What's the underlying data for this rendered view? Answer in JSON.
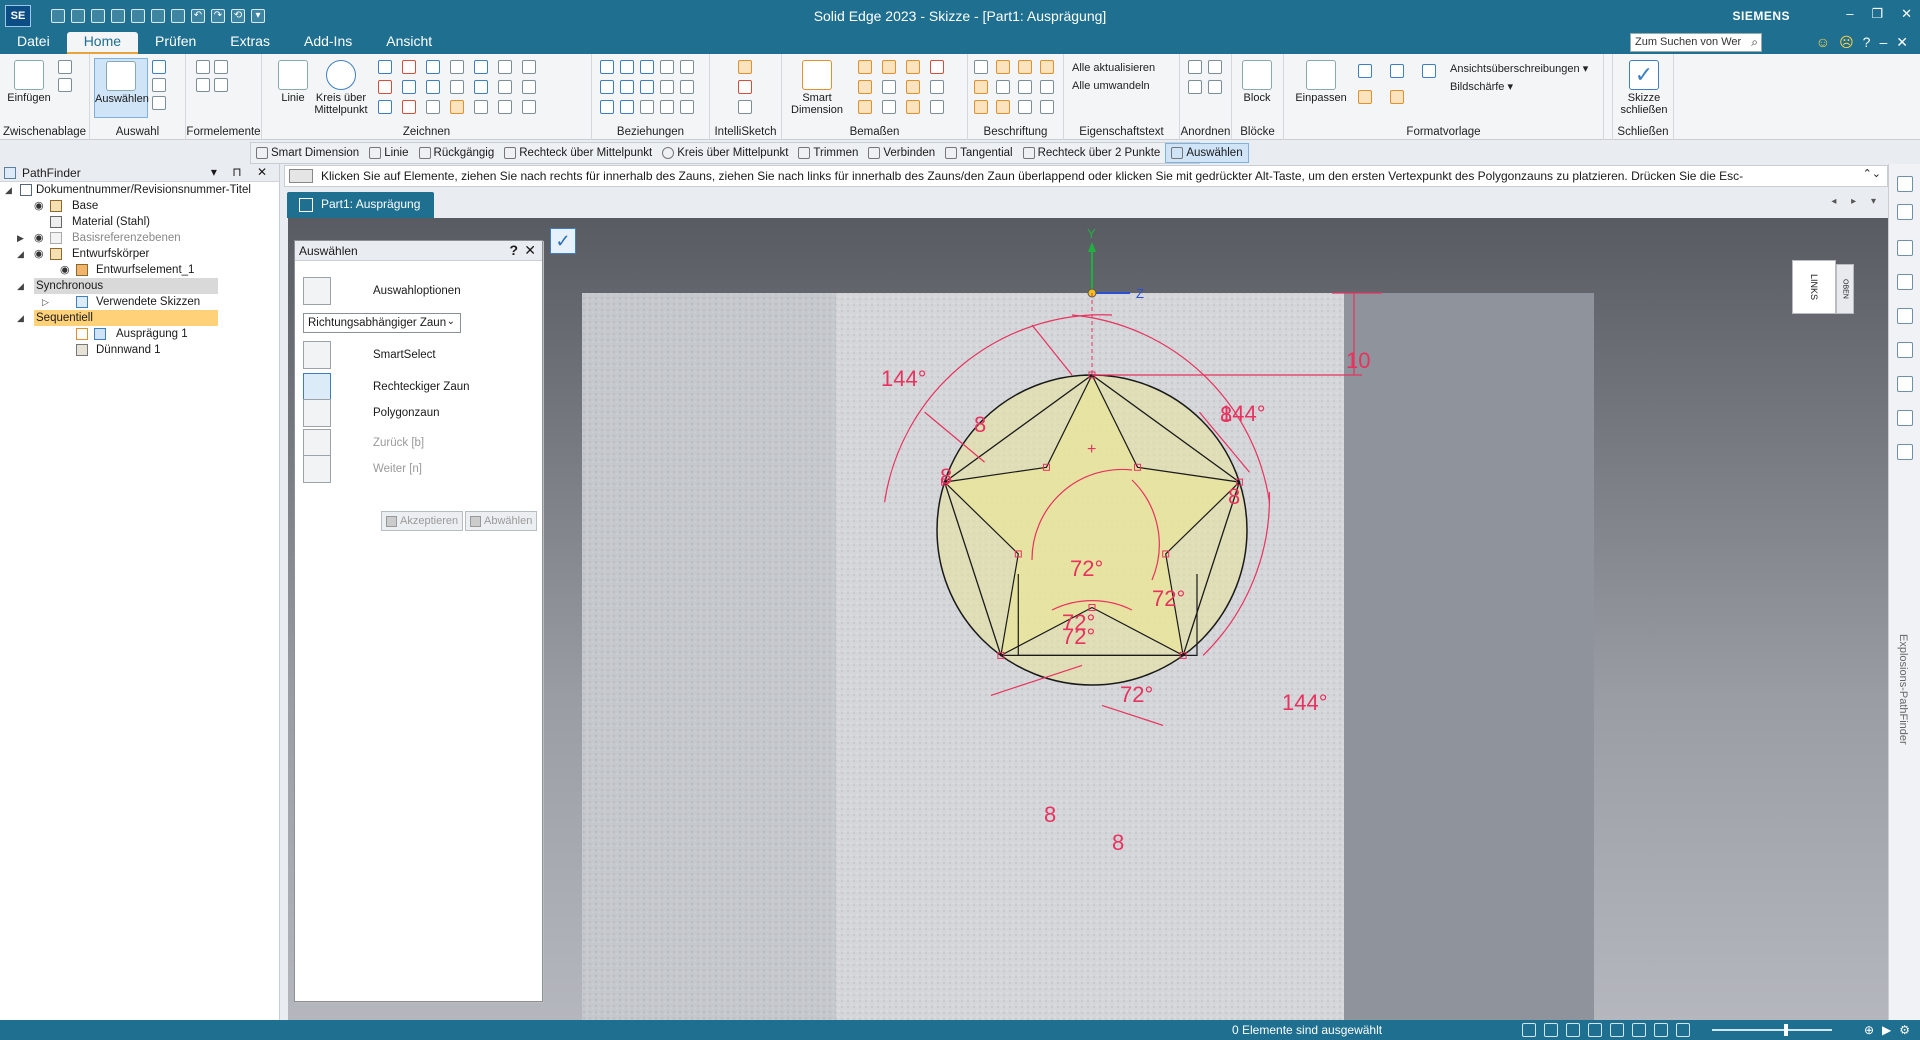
{
  "app": {
    "logo": "SE",
    "title": "Solid Edge 2023 - Skizze - [Part1: Ausprägung]",
    "brand": "SIEMENS",
    "window_controls": [
      "–",
      "❐",
      "✕"
    ]
  },
  "menu": {
    "items": [
      "Datei",
      "Home",
      "Prüfen",
      "Extras",
      "Add-Ins",
      "Ansicht"
    ],
    "search_placeholder": "Zum Suchen von Wer",
    "feedback_icons": [
      "☺",
      "☹",
      "?",
      "–",
      "✕"
    ]
  },
  "ribbon": {
    "groups": {
      "zwischenablage": "Zwischenablage",
      "auswahl": "Auswahl",
      "formelemente": "Formelemente",
      "zeichnen": "Zeichnen",
      "beziehungen": "Beziehungen",
      "intellisketch": "IntelliSketch",
      "bemassen": "Bemaßen",
      "beschriftung": "Beschriftung",
      "eigenschaftstext": "Eigenschaftstext",
      "anordnen": "Anordnen",
      "bloecke": "Blöcke",
      "formatvorlage": "Formatvorlage",
      "schliessen": "Schließen"
    },
    "buttons": {
      "einfuegen": "Einfügen",
      "auswaehlen": "Auswählen",
      "linie": "Linie",
      "kreis": "Kreis über Mittelpunkt",
      "smart_dimension": "Smart Dimension",
      "block": "Block",
      "einpassen": "Einpassen",
      "skizze_schliessen": "Skizze schließen",
      "alle_aktualisieren": "Alle aktualisieren",
      "alle_umwandeln": "Alle umwandeln",
      "ansichtsueberschreibungen": "Ansichtsüberschreibungen",
      "bildschaerfe": "Bildschärfe"
    }
  },
  "command_bar": {
    "items": [
      "Smart Dimension",
      "Linie",
      "Rückgängig",
      "Rechteck über Mittelpunkt",
      "Kreis über Mittelpunkt",
      "Trimmen",
      "Verbinden",
      "Tangential",
      "Rechteck über 2 Punkte",
      "Auswählen"
    ]
  },
  "prompt": "Klicken Sie auf Elemente, ziehen Sie nach rechts für innerhalb des Zauns, ziehen Sie nach links für innerhalb des Zauns/den Zaun überlappend oder klicken Sie mit gedrückter Alt-Taste, um den ersten Vertexpunkt des Polygonzauns zu platzieren. Drücken Sie die Esc-",
  "pathfinder": {
    "title": "PathFinder",
    "controls": "▾ ⊓ ✕",
    "tree": {
      "root": "Dokumentnummer/Revisionsnummer-Titel",
      "base": "Base",
      "material": "Material (Stahl)",
      "basisreferenzebenen": "Basisreferenzebenen",
      "entwurfskoerper": "Entwurfskörper",
      "entwurfselement": "Entwurfselement_1",
      "synchronous": "Synchronous",
      "verwendete_skizzen": "Verwendete Skizzen",
      "sequentiell": "Sequentiell",
      "auspraegung": "Ausprägung 1",
      "duennwand": "Dünnwand 1"
    }
  },
  "document": {
    "tab": "Part1: Ausprägung",
    "tab_nav": "◂ ▸ ▾"
  },
  "select_panel": {
    "title": "Auswählen",
    "help": "?",
    "close": "✕",
    "options_label": "Auswahloptionen",
    "fence_mode": "Richtungsabhängiger Zaun",
    "smartselect": "SmartSelect",
    "rect_fence": "Rechteckiger Zaun",
    "poly_fence": "Polygonzaun",
    "back": "Zurück [b]",
    "forward": "Weiter [n]",
    "accept": "Akzeptieren",
    "deselect": "Abwählen"
  },
  "viewcube": {
    "face": "LINKS",
    "side": "OBEN"
  },
  "axes": {
    "y": "Y",
    "z": "Z"
  },
  "right_dock": {
    "label": "Explosions-PathFinder"
  },
  "status": {
    "text": "0 Elemente sind ausgewählt"
  },
  "sketch": {
    "dimensions": {
      "angle_top_left": "144°",
      "angle_top_right": "144°",
      "angle_right": "144°",
      "length_top_left": "8",
      "length_left": "8",
      "length_right": "8",
      "length_top_right_overlap": "8",
      "length_bottom_left": "8",
      "length_bottom_right": "8",
      "height": "10",
      "angle_center_1": "72°",
      "angle_center_2": "72°",
      "angle_center_3": "72°",
      "angle_center_4": "72°",
      "angle_center_5": "72°"
    },
    "colors": {
      "dimension": "#e8325f",
      "fill": "#e9e59a",
      "geometry": "#1a1a1a",
      "accent": "#1e6f90"
    }
  }
}
